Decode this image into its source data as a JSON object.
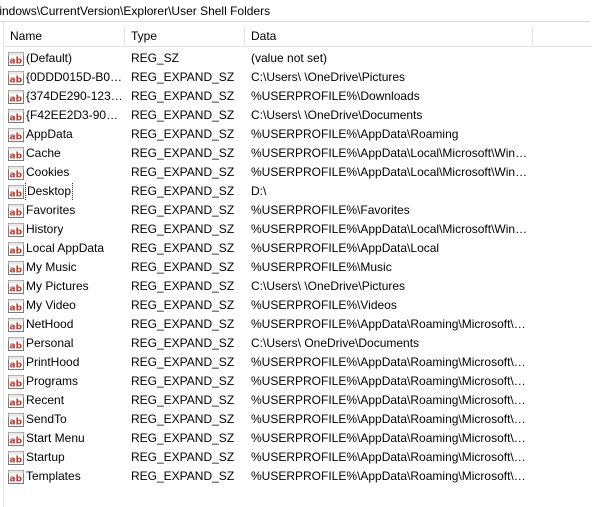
{
  "address": {
    "path": "/indows\\CurrentVersion\\Explorer\\User Shell Folders"
  },
  "columns": {
    "name": "Name",
    "type": "Type",
    "data": "Data"
  },
  "colors": {
    "icon_red": "#c0392b",
    "focus_outline": "#333333"
  },
  "icon": "reg-string-ab-icon",
  "rows": [
    {
      "name": "(Default)",
      "type": "REG_SZ",
      "data": "(value not set)"
    },
    {
      "name": "{0DDD015D-B06...",
      "type": "REG_EXPAND_SZ",
      "data": "C:\\Users\\        \\OneDrive\\Pictures"
    },
    {
      "name": "{374DE290-123F...",
      "type": "REG_EXPAND_SZ",
      "data": "%USERPROFILE%\\Downloads"
    },
    {
      "name": "{F42EE2D3-909F...",
      "type": "REG_EXPAND_SZ",
      "data": "C:\\Users\\        \\OneDrive\\Documents"
    },
    {
      "name": "AppData",
      "type": "REG_EXPAND_SZ",
      "data": "%USERPROFILE%\\AppData\\Roaming"
    },
    {
      "name": "Cache",
      "type": "REG_EXPAND_SZ",
      "data": "%USERPROFILE%\\AppData\\Local\\Microsoft\\Wind..."
    },
    {
      "name": "Cookies",
      "type": "REG_EXPAND_SZ",
      "data": "%USERPROFILE%\\AppData\\Local\\Microsoft\\Wind..."
    },
    {
      "name": "Desktop",
      "type": "REG_EXPAND_SZ",
      "data": "D:\\",
      "focused": true
    },
    {
      "name": "Favorites",
      "type": "REG_EXPAND_SZ",
      "data": "%USERPROFILE%\\Favorites"
    },
    {
      "name": "History",
      "type": "REG_EXPAND_SZ",
      "data": "%USERPROFILE%\\AppData\\Local\\Microsoft\\Wind..."
    },
    {
      "name": "Local AppData",
      "type": "REG_EXPAND_SZ",
      "data": "%USERPROFILE%\\AppData\\Local"
    },
    {
      "name": "My Music",
      "type": "REG_EXPAND_SZ",
      "data": "%USERPROFILE%\\Music"
    },
    {
      "name": "My Pictures",
      "type": "REG_EXPAND_SZ",
      "data": "C:\\Users\\        \\OneDrive\\Pictures"
    },
    {
      "name": "My Video",
      "type": "REG_EXPAND_SZ",
      "data": "%USERPROFILE%\\Videos"
    },
    {
      "name": "NetHood",
      "type": "REG_EXPAND_SZ",
      "data": "%USERPROFILE%\\AppData\\Roaming\\Microsoft\\W..."
    },
    {
      "name": "Personal",
      "type": "REG_EXPAND_SZ",
      "data": "C:\\Users\\         OneDrive\\Documents"
    },
    {
      "name": "PrintHood",
      "type": "REG_EXPAND_SZ",
      "data": "%USERPROFILE%\\AppData\\Roaming\\Microsoft\\W..."
    },
    {
      "name": "Programs",
      "type": "REG_EXPAND_SZ",
      "data": "%USERPROFILE%\\AppData\\Roaming\\Microsoft\\W..."
    },
    {
      "name": "Recent",
      "type": "REG_EXPAND_SZ",
      "data": "%USERPROFILE%\\AppData\\Roaming\\Microsoft\\W..."
    },
    {
      "name": "SendTo",
      "type": "REG_EXPAND_SZ",
      "data": "%USERPROFILE%\\AppData\\Roaming\\Microsoft\\W..."
    },
    {
      "name": "Start Menu",
      "type": "REG_EXPAND_SZ",
      "data": "%USERPROFILE%\\AppData\\Roaming\\Microsoft\\W..."
    },
    {
      "name": "Startup",
      "type": "REG_EXPAND_SZ",
      "data": "%USERPROFILE%\\AppData\\Roaming\\Microsoft\\W..."
    },
    {
      "name": "Templates",
      "type": "REG_EXPAND_SZ",
      "data": "%USERPROFILE%\\AppData\\Roaming\\Microsoft\\W..."
    }
  ]
}
